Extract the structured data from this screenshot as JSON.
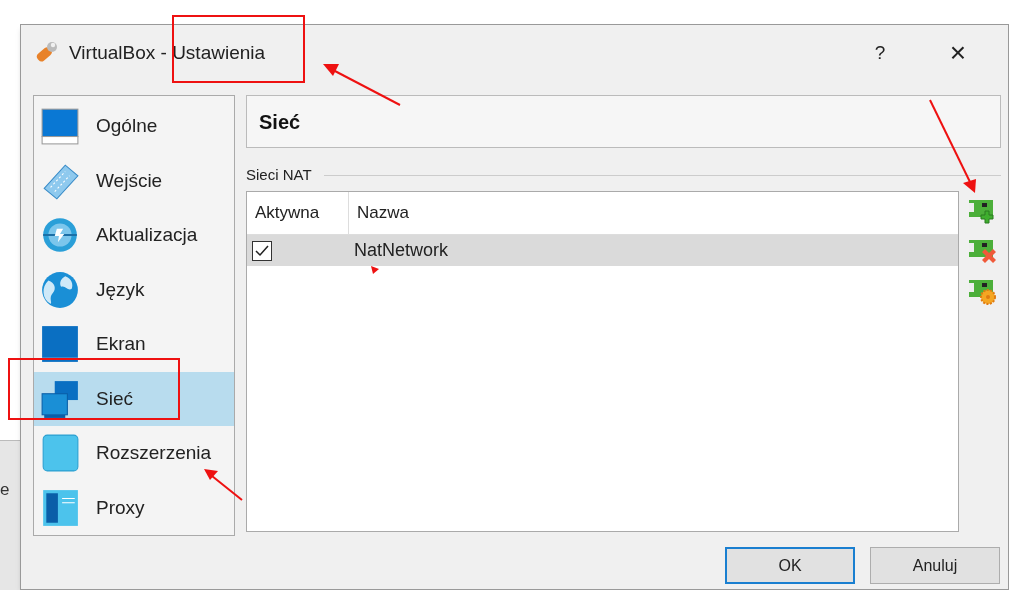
{
  "background_window": {
    "text": "e"
  },
  "window": {
    "title": "VirtualBox - Ustawienia",
    "help": "?",
    "close": "×"
  },
  "sidebar": {
    "items": [
      {
        "label": "Ogólne",
        "selected": false
      },
      {
        "label": "Wejście",
        "selected": false
      },
      {
        "label": "Aktualizacja",
        "selected": false
      },
      {
        "label": "Język",
        "selected": false
      },
      {
        "label": "Ekran",
        "selected": false
      },
      {
        "label": "Sieć",
        "selected": true
      },
      {
        "label": "Rozszerzenia",
        "selected": false
      },
      {
        "label": "Proxy",
        "selected": false
      }
    ]
  },
  "page": {
    "title": "Sieć",
    "section": "Sieci NAT"
  },
  "table": {
    "columns": [
      "Aktywna",
      "Nazwa"
    ],
    "rows": [
      {
        "checked": true,
        "name": "NatNetwork",
        "selected": true
      }
    ]
  },
  "buttons": [
    {
      "label": "OK",
      "default": true
    },
    {
      "label": "Anuluj",
      "default": false
    }
  ]
}
